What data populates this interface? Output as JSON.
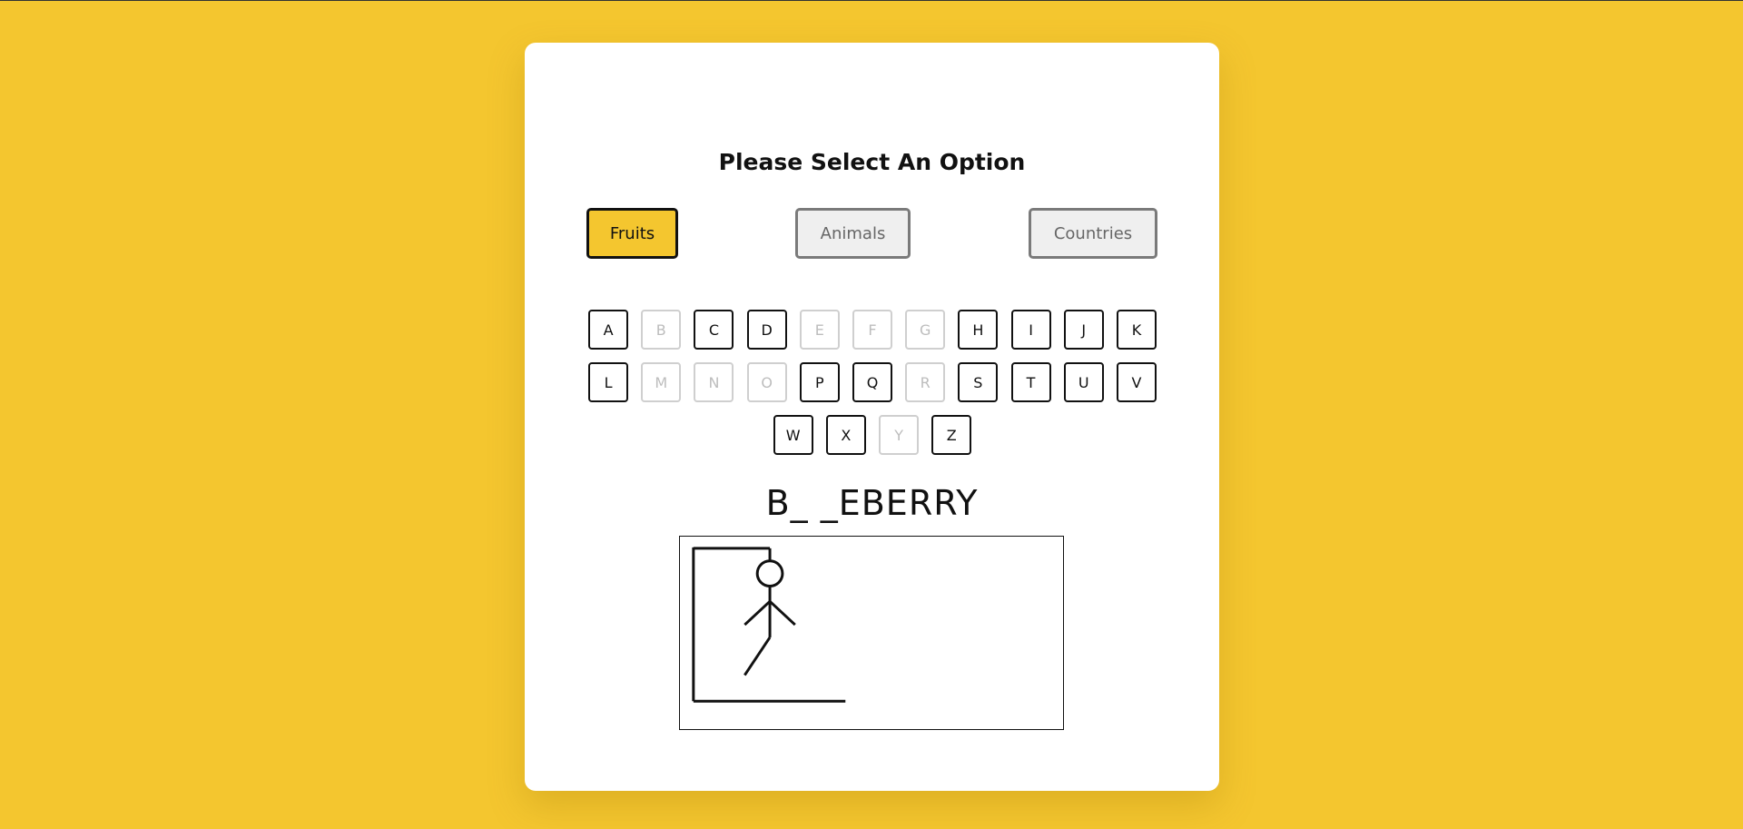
{
  "page": {
    "background_color": "#f4c62f",
    "card_color": "#ffffff"
  },
  "heading": "Please Select An Option",
  "options": [
    {
      "label": "Fruits",
      "selected": true
    },
    {
      "label": "Animals",
      "selected": false
    },
    {
      "label": "Countries",
      "selected": false
    }
  ],
  "letters": [
    {
      "char": "A",
      "used": false
    },
    {
      "char": "B",
      "used": true
    },
    {
      "char": "C",
      "used": false
    },
    {
      "char": "D",
      "used": false
    },
    {
      "char": "E",
      "used": true
    },
    {
      "char": "F",
      "used": true
    },
    {
      "char": "G",
      "used": true
    },
    {
      "char": "H",
      "used": false
    },
    {
      "char": "I",
      "used": false
    },
    {
      "char": "J",
      "used": false
    },
    {
      "char": "K",
      "used": false
    },
    {
      "char": "L",
      "used": false
    },
    {
      "char": "M",
      "used": true
    },
    {
      "char": "N",
      "used": true
    },
    {
      "char": "O",
      "used": true
    },
    {
      "char": "P",
      "used": false
    },
    {
      "char": "Q",
      "used": false
    },
    {
      "char": "R",
      "used": true
    },
    {
      "char": "S",
      "used": false
    },
    {
      "char": "T",
      "used": false
    },
    {
      "char": "U",
      "used": false
    },
    {
      "char": "V",
      "used": false
    },
    {
      "char": "W",
      "used": false
    },
    {
      "char": "X",
      "used": false
    },
    {
      "char": "Y",
      "used": true
    },
    {
      "char": "Z",
      "used": false
    }
  ],
  "word_display": "B_ _EBERRY",
  "hangman": {
    "drawn_parts": [
      "base",
      "pole",
      "beam",
      "rope",
      "head",
      "body",
      "left-arm",
      "right-arm",
      "left-leg"
    ]
  },
  "colors": {
    "accent": "#f4c62f",
    "inactive_button_bg": "#efefef",
    "inactive_button_border": "#7a7a7a",
    "used_letter": "#bdbdbd"
  }
}
